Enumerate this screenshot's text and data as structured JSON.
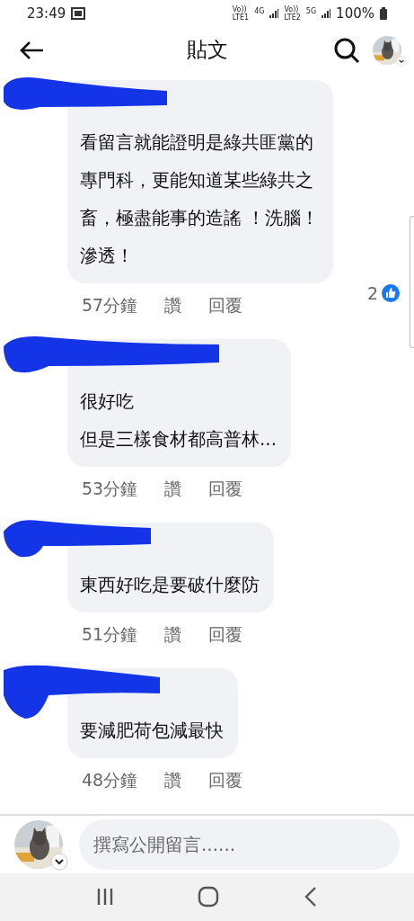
{
  "status_bar": {
    "time": "23:49",
    "sim_1": {
      "volte": "Vo))",
      "label": "LTE1",
      "network": "4G"
    },
    "sim_2": {
      "volte": "Vo))",
      "label": "LTE2",
      "network": "5G"
    },
    "battery": "100%"
  },
  "header": {
    "title": "貼文"
  },
  "comments": [
    {
      "lines": [
        "看留言就能證明是綠共匪黨的",
        "專門科，更能知道某些綠共之",
        "畜，極盡能事的造謠 ！洗腦！",
        "滲透！"
      ],
      "time": "57分鐘",
      "like": "讚",
      "reply": "回覆",
      "reactions": "2"
    },
    {
      "lines": [
        "很好吃",
        "但是三樣食材都高普林..."
      ],
      "time": "53分鐘",
      "like": "讚",
      "reply": "回覆"
    },
    {
      "lines": [
        "東西好吃是要破什麼防"
      ],
      "time": "51分鐘",
      "like": "讚",
      "reply": "回覆"
    },
    {
      "lines": [
        "要減肥荷包減最快"
      ],
      "time": "48分鐘",
      "like": "讚",
      "reply": "回覆"
    }
  ],
  "composer": {
    "placeholder": "撰寫公開留言......"
  }
}
